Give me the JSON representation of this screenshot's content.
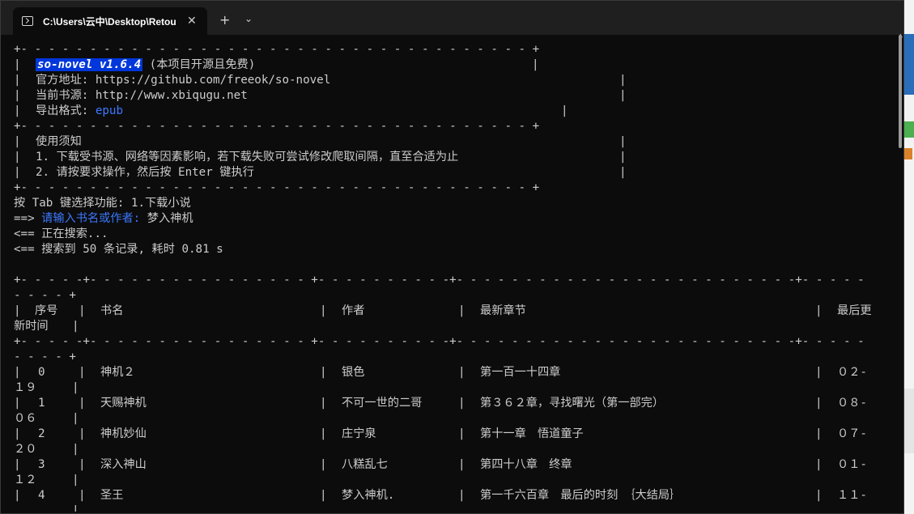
{
  "window": {
    "tab_title": "C:\\Users\\云中\\Desktop\\Retou",
    "close_glyph": "✕",
    "new_tab_glyph": "+",
    "dropdown_glyph": "⌄"
  },
  "banner": {
    "border": "+- - - - - - - - - - - - - - - - - - - - - - - - - - - - - - - - - - - - - +",
    "pipe": "|",
    "version": "so-novel v1.6.4",
    "version_note": "(本项目开源且免费)",
    "official_label": "官方地址: ",
    "official_url": "https://github.com/freeok/so-novel",
    "source_label": "当前书源: ",
    "source_url": "http://www.xbiqugu.net",
    "format_label": "导出格式: ",
    "format_value": "epub",
    "notice_title": "使用须知",
    "notice_1": "1. 下载受书源、网络等因素影响，若下载失败可尝试修改爬取间隔，直至合适为止",
    "notice_2": "2. 请按要求操作，然后按 Enter 键执行"
  },
  "session": {
    "tab_line": "按 Tab 键选择功能: 1.下载小说",
    "prompt_arrow": "==> ",
    "prompt_label": "请输入书名或作者: ",
    "prompt_value": "梦入神机",
    "searching": "<== 正在搜索...",
    "result": "<== 搜索到 50 条记录, 耗时 0.81 s"
  },
  "table": {
    "border_top": "+- - - - -+- - - - - - - - - - - - - - - - +- - - - - - - - - -+- - - - - - - - - - - - - - - - - - - - - - - - -+- - - - -",
    "border_wrap": "- - - - +",
    "columns": {
      "index": "序号",
      "title": "书名",
      "author": "作者",
      "latest": "最新章节",
      "updated_a": "最后更",
      "updated_b": "新时间"
    },
    "rows": [
      {
        "index": "0",
        "title": "神机２",
        "author": "银色",
        "latest": "第一百一十四章",
        "date_a": "０２-",
        "date_b": "１９"
      },
      {
        "index": "1",
        "title": "天赐神机",
        "author": "不可一世的二哥",
        "latest": "第３６２章，寻找曙光（第一部完）",
        "date_a": "０８-",
        "date_b": "０６"
      },
      {
        "index": "2",
        "title": "神机妙仙",
        "author": "庄宁泉",
        "latest": "第十一章　悟道童子",
        "date_a": "０７-",
        "date_b": "２０"
      },
      {
        "index": "3",
        "title": "深入神山",
        "author": "八糕乱七",
        "latest": "第四十八章　终章",
        "date_a": "０１-",
        "date_b": "１２"
      },
      {
        "index": "4",
        "title": "圣王",
        "author": "梦入神机.",
        "latest": "第一千六百章　最后的时刻　｛大结局｝",
        "date_a": "１１-",
        "date_b": ""
      }
    ]
  }
}
